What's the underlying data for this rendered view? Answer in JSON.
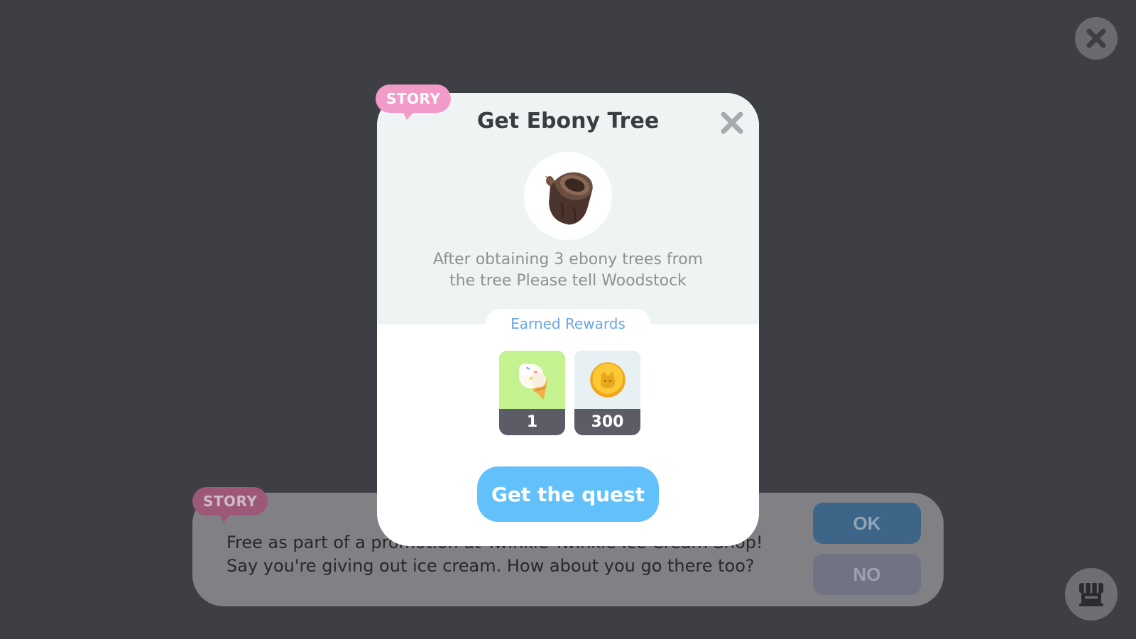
{
  "top_bar": {
    "close_icon": "close-icon"
  },
  "story_dialog": {
    "tag": "STORY",
    "lines": [
      "Free as part of a promotion at Twinkle Twinkle Ice Cream Shop!",
      "Say you're giving out ice cream. How about you go there too?"
    ],
    "ok_label": "OK",
    "no_label": "NO"
  },
  "shop": {
    "icon": "shop-icon"
  },
  "quest_modal": {
    "tag": "STORY",
    "title": "Get Ebony Tree",
    "item_icon": "ebony-log-icon",
    "description_lines": [
      "After obtaining 3 ebony trees from",
      "the tree Please tell Woodstock"
    ],
    "rewards_label": "Earned Rewards",
    "rewards": [
      {
        "icon": "ice-cream-icon",
        "quantity": "1"
      },
      {
        "icon": "gold-coin-icon",
        "quantity": "300"
      }
    ],
    "action_label": "Get the quest",
    "colors": {
      "story_tag": "#f29bc9",
      "action_button": "#62c0fb",
      "rewards_label": "#6aa7e6"
    }
  }
}
